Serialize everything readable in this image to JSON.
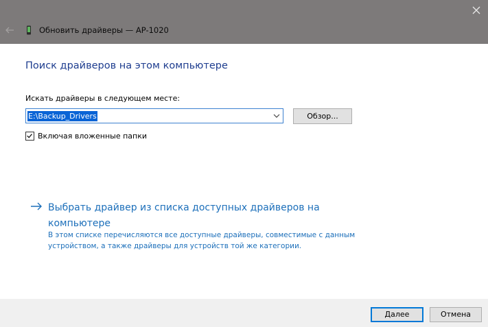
{
  "titlebar": {
    "title": "Обновить драйверы — AP-1020",
    "back_icon": "back-arrow-icon",
    "close_icon": "close-icon",
    "device_icon": "device-icon"
  },
  "main": {
    "heading": "Поиск драйверов на этом компьютере",
    "search_label": "Искать драйверы в следующем месте:",
    "path_value": "E:\\Backup_Drivers",
    "browse_label": "Обзор...",
    "include_subfolders_label": "Включая вложенные папки",
    "include_subfolders_checked": true,
    "pick_link": "Выбрать драйвер из списка доступных драйверов на компьютере",
    "pick_description": "В этом списке перечисляются все доступные драйверы, совместимые с данным устройством, а также драйверы для устройств той же категории."
  },
  "footer": {
    "next_label": "Далее",
    "cancel_label": "Отмена"
  },
  "colors": {
    "titlebar_bg": "#7d7a7a",
    "heading": "#1e3d8f",
    "link": "#1c6fba",
    "selection": "#0a64d6",
    "accent": "#0078d7"
  }
}
